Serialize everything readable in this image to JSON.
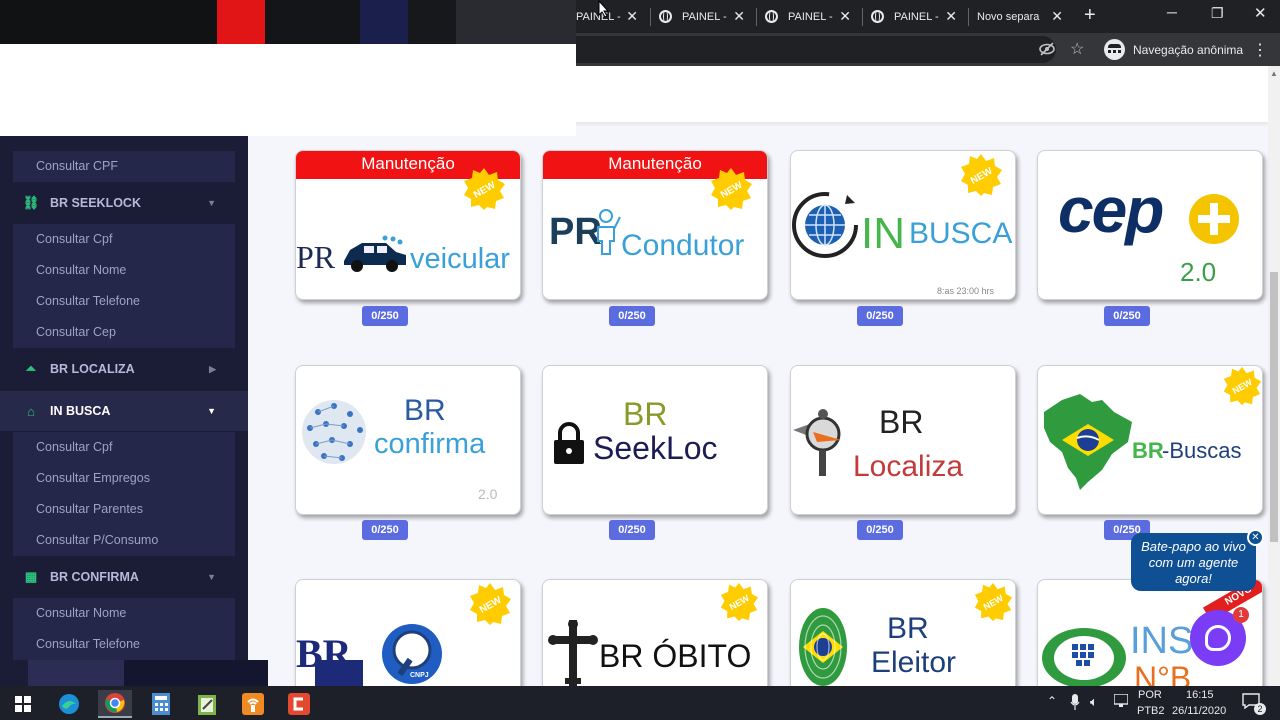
{
  "browser": {
    "tabs": [
      {
        "label": "PAINEL -"
      },
      {
        "label": "PAINEL -"
      },
      {
        "label": "PAINEL -"
      },
      {
        "label": "PAINEL -"
      },
      {
        "label": "Novo separa"
      }
    ],
    "new_tab_symbol": "+",
    "incognito_label": "Navegação anônima",
    "colors": {
      "tab_strip": "#202124",
      "toolbar": "#35363a"
    }
  },
  "sidebar": {
    "items": [
      {
        "label": "Consultar CPF"
      },
      {
        "section": "BR SEEKLOCK",
        "icon": "link-icon"
      },
      {
        "label": "Consultar Cpf"
      },
      {
        "label": "Consultar Nome"
      },
      {
        "label": "Consultar Telefone"
      },
      {
        "label": "Consultar Cep"
      },
      {
        "section": "BR LOCALIZA",
        "icon": "pulse-icon"
      },
      {
        "section": "IN BUSCA",
        "icon": "inbox-icon"
      },
      {
        "label": "Consultar Cpf"
      },
      {
        "label": "Consultar Empregos"
      },
      {
        "label": "Consultar Parentes"
      },
      {
        "label": "Consultar P/Consumo"
      },
      {
        "section": "BR CONFIRMA",
        "icon": "table-icon"
      },
      {
        "label": "Consultar Nome"
      },
      {
        "label": "Consultar Telefone"
      }
    ],
    "colors": {
      "background": "#1b1d37",
      "accent": "#2ec27e"
    }
  },
  "cards": [
    {
      "ribbon": "Manutenção",
      "logo_main": "PR",
      "logo_sub": "veicular",
      "new": "NEW",
      "usage": "0/250"
    },
    {
      "ribbon": "Manutenção",
      "logo_main": "PR",
      "logo_sub": "Condutor",
      "new": "NEW",
      "usage": "0/250"
    },
    {
      "logo_main": "IN",
      "logo_sub": "BUSCA",
      "note": "8:as 23:00 hrs",
      "new": "NEW",
      "usage": "0/250"
    },
    {
      "logo_main": "cep",
      "logo_sub": "2.0",
      "usage": "0/250"
    },
    {
      "logo_main": "BR",
      "logo_sub": "confirma",
      "note": "2.0",
      "usage": "0/250"
    },
    {
      "logo_main": "BR",
      "logo_sub": "SeekLoc",
      "usage": "0/250"
    },
    {
      "logo_main": "BR",
      "logo_sub": "Localiza",
      "usage": "0/250"
    },
    {
      "logo_main": "BR",
      "logo_sub": "-Buscas",
      "new": "NEW",
      "usage": "0/250"
    },
    {
      "logo_main": "BR",
      "logo_sub": "CNPJ",
      "new": "NEW"
    },
    {
      "logo_main": "BR ÓBITO",
      "new": "NEW"
    },
    {
      "logo_main": "BR",
      "logo_sub": "Eleitor",
      "new": "NEW"
    },
    {
      "logo_main": "INS",
      "logo_sub": "N°B",
      "new": "NOVO"
    }
  ],
  "chat": {
    "bubble": "Bate-papo ao vivo com um agente agora!",
    "count": "1"
  },
  "taskbar": {
    "lang_top": "POR",
    "lang_bottom": "PTB2",
    "time": "16:15",
    "date": "26/11/2020",
    "notifications": "2"
  }
}
